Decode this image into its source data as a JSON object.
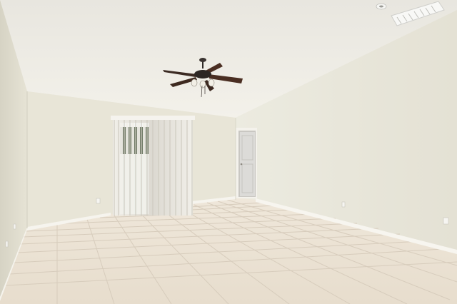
{
  "scene": {
    "type": "photo",
    "subject": "empty-room",
    "fixtures": [
      "ceiling-fan",
      "sliding-glass-door",
      "vertical-blinds",
      "interior-door",
      "air-vent",
      "smoke-detector",
      "electrical-outlet",
      "baseboard"
    ],
    "floor": "ceramic-tile",
    "colors": {
      "ceiling": "#efede6",
      "wall_left": "#e3e0d2",
      "wall_back": "#e9e6d8",
      "wall_right": "#ebe8dc",
      "floor": "#ece3d5",
      "grout": "#d6cbbb",
      "fan_blade": "#4a2e22",
      "baseboard": "#f6f4ee"
    }
  },
  "watermark": {
    "text": ""
  }
}
